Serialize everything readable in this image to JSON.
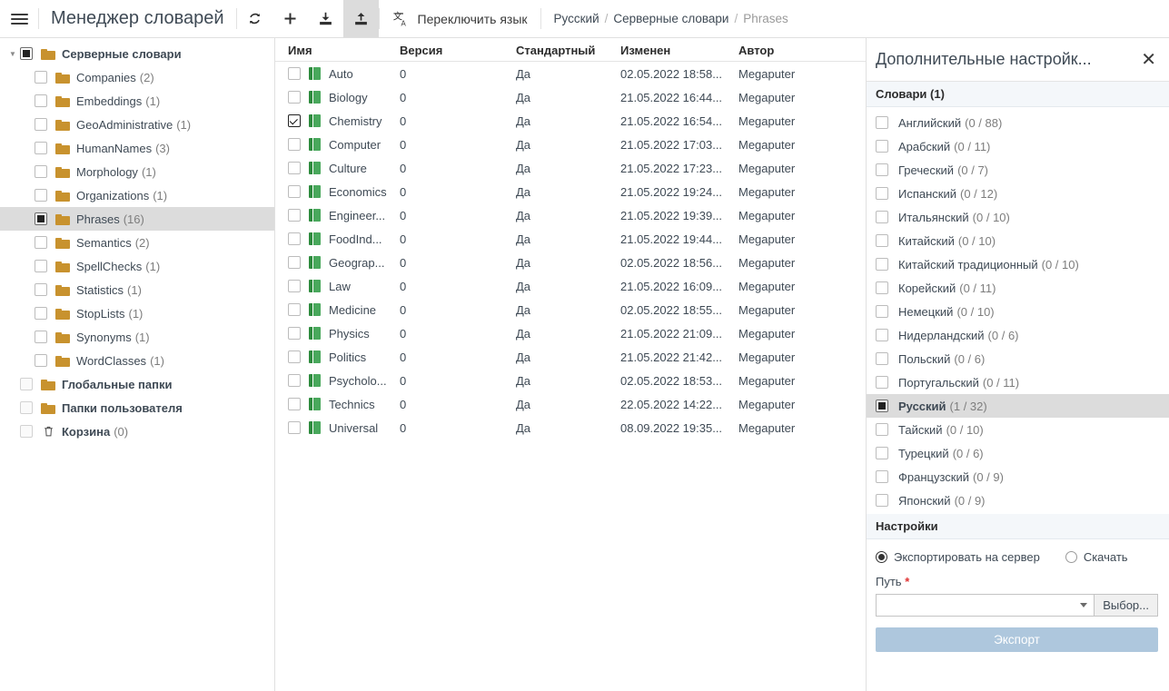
{
  "topbar": {
    "menu_icon": "hamburger-icon",
    "title": "Менеджер словарей",
    "buttons": [
      {
        "name": "refresh-button",
        "icon": "refresh-icon",
        "active": false
      },
      {
        "name": "add-button",
        "icon": "plus-icon",
        "active": false
      },
      {
        "name": "import-button",
        "icon": "download-icon",
        "active": false
      },
      {
        "name": "export-button",
        "icon": "upload-icon",
        "active": true
      }
    ],
    "language_switch": {
      "icon": "translate-icon",
      "label": "Переключить язык"
    },
    "breadcrumb": [
      {
        "label": "Русский",
        "current": false
      },
      {
        "label": "Серверные словари",
        "current": false
      },
      {
        "label": "Phrases",
        "current": true
      }
    ],
    "breadcrumb_separator": "/"
  },
  "sidebar": {
    "items": [
      {
        "label": "Серверные словари",
        "count": "",
        "level": 0,
        "bold": true,
        "icon": "folder-icon",
        "checkbox": "indeterminate",
        "caret": "▼",
        "selected": false
      },
      {
        "label": "Companies",
        "count": "(2)",
        "level": 1,
        "bold": false,
        "icon": "folder-icon",
        "checkbox": "unchecked",
        "caret": "",
        "selected": false
      },
      {
        "label": "Embeddings",
        "count": "(1)",
        "level": 1,
        "bold": false,
        "icon": "folder-icon",
        "checkbox": "unchecked",
        "caret": "",
        "selected": false
      },
      {
        "label": "GeoAdministrative",
        "count": "(1)",
        "level": 1,
        "bold": false,
        "icon": "folder-icon",
        "checkbox": "unchecked",
        "caret": "",
        "selected": false
      },
      {
        "label": "HumanNames",
        "count": "(3)",
        "level": 1,
        "bold": false,
        "icon": "folder-icon",
        "checkbox": "unchecked",
        "caret": "",
        "selected": false
      },
      {
        "label": "Morphology",
        "count": "(1)",
        "level": 1,
        "bold": false,
        "icon": "folder-icon",
        "checkbox": "unchecked",
        "caret": "",
        "selected": false
      },
      {
        "label": "Organizations",
        "count": "(1)",
        "level": 1,
        "bold": false,
        "icon": "folder-icon",
        "checkbox": "unchecked",
        "caret": "",
        "selected": false
      },
      {
        "label": "Phrases",
        "count": "(16)",
        "level": 1,
        "bold": false,
        "icon": "folder-icon",
        "checkbox": "indeterminate",
        "caret": "",
        "selected": true
      },
      {
        "label": "Semantics",
        "count": "(2)",
        "level": 1,
        "bold": false,
        "icon": "folder-icon",
        "checkbox": "unchecked",
        "caret": "",
        "selected": false
      },
      {
        "label": "SpellChecks",
        "count": "(1)",
        "level": 1,
        "bold": false,
        "icon": "folder-icon",
        "checkbox": "unchecked",
        "caret": "",
        "selected": false
      },
      {
        "label": "Statistics",
        "count": "(1)",
        "level": 1,
        "bold": false,
        "icon": "folder-icon",
        "checkbox": "unchecked",
        "caret": "",
        "selected": false
      },
      {
        "label": "StopLists",
        "count": "(1)",
        "level": 1,
        "bold": false,
        "icon": "folder-icon",
        "checkbox": "unchecked",
        "caret": "",
        "selected": false
      },
      {
        "label": "Synonyms",
        "count": "(1)",
        "level": 1,
        "bold": false,
        "icon": "folder-icon",
        "checkbox": "unchecked",
        "caret": "",
        "selected": false
      },
      {
        "label": "WordClasses",
        "count": "(1)",
        "level": 1,
        "bold": false,
        "icon": "folder-icon",
        "checkbox": "unchecked",
        "caret": "",
        "selected": false
      },
      {
        "label": "Глобальные папки",
        "count": "",
        "level": 0,
        "bold": true,
        "icon": "folder-icon",
        "checkbox": "dim",
        "caret": "",
        "selected": false
      },
      {
        "label": "Папки пользователя",
        "count": "",
        "level": 0,
        "bold": true,
        "icon": "folder-icon",
        "checkbox": "dim",
        "caret": "",
        "selected": false
      },
      {
        "label": "Корзина",
        "count": "(0)",
        "level": 0,
        "bold": true,
        "icon": "trash-icon",
        "checkbox": "dim",
        "caret": "",
        "selected": false
      }
    ]
  },
  "table": {
    "columns": [
      "Имя",
      "Версия",
      "Стандартный",
      "Изменен",
      "Автор"
    ],
    "rows": [
      {
        "checkbox": "unchecked",
        "name": "Auto",
        "version": "0",
        "standard": "Да",
        "modified": "02.05.2022 18:58...",
        "author": "Megaputer"
      },
      {
        "checkbox": "unchecked",
        "name": "Biology",
        "version": "0",
        "standard": "Да",
        "modified": "21.05.2022 16:44...",
        "author": "Megaputer"
      },
      {
        "checkbox": "checked",
        "name": "Chemistry",
        "version": "0",
        "standard": "Да",
        "modified": "21.05.2022 16:54...",
        "author": "Megaputer"
      },
      {
        "checkbox": "unchecked",
        "name": "Computer",
        "version": "0",
        "standard": "Да",
        "modified": "21.05.2022 17:03...",
        "author": "Megaputer"
      },
      {
        "checkbox": "unchecked",
        "name": "Culture",
        "version": "0",
        "standard": "Да",
        "modified": "21.05.2022 17:23...",
        "author": "Megaputer"
      },
      {
        "checkbox": "unchecked",
        "name": "Economics",
        "version": "0",
        "standard": "Да",
        "modified": "21.05.2022 19:24...",
        "author": "Megaputer"
      },
      {
        "checkbox": "unchecked",
        "name": "Engineer...",
        "version": "0",
        "standard": "Да",
        "modified": "21.05.2022 19:39...",
        "author": "Megaputer"
      },
      {
        "checkbox": "unchecked",
        "name": "FoodInd...",
        "version": "0",
        "standard": "Да",
        "modified": "21.05.2022 19:44...",
        "author": "Megaputer"
      },
      {
        "checkbox": "unchecked",
        "name": "Geograp...",
        "version": "0",
        "standard": "Да",
        "modified": "02.05.2022 18:56...",
        "author": "Megaputer"
      },
      {
        "checkbox": "unchecked",
        "name": "Law",
        "version": "0",
        "standard": "Да",
        "modified": "21.05.2022 16:09...",
        "author": "Megaputer"
      },
      {
        "checkbox": "unchecked",
        "name": "Medicine",
        "version": "0",
        "standard": "Да",
        "modified": "02.05.2022 18:55...",
        "author": "Megaputer"
      },
      {
        "checkbox": "unchecked",
        "name": "Physics",
        "version": "0",
        "standard": "Да",
        "modified": "21.05.2022 21:09...",
        "author": "Megaputer"
      },
      {
        "checkbox": "unchecked",
        "name": "Politics",
        "version": "0",
        "standard": "Да",
        "modified": "21.05.2022 21:42...",
        "author": "Megaputer"
      },
      {
        "checkbox": "unchecked",
        "name": "Psycholo...",
        "version": "0",
        "standard": "Да",
        "modified": "02.05.2022 18:53...",
        "author": "Megaputer"
      },
      {
        "checkbox": "unchecked",
        "name": "Technics",
        "version": "0",
        "standard": "Да",
        "modified": "22.05.2022 14:22...",
        "author": "Megaputer"
      },
      {
        "checkbox": "unchecked",
        "name": "Universal",
        "version": "0",
        "standard": "Да",
        "modified": "08.09.2022 19:35...",
        "author": "Megaputer"
      }
    ]
  },
  "right_panel": {
    "title": "Дополнительные настройк...",
    "close_icon": "close-icon",
    "dictionaries_header": "Словари (1)",
    "languages": [
      {
        "label": "Английский",
        "count": "(0 / 88)",
        "checkbox": "unchecked",
        "selected": false
      },
      {
        "label": "Арабский",
        "count": "(0 / 11)",
        "checkbox": "unchecked",
        "selected": false
      },
      {
        "label": "Греческий",
        "count": "(0 / 7)",
        "checkbox": "unchecked",
        "selected": false
      },
      {
        "label": "Испанский",
        "count": "(0 / 12)",
        "checkbox": "unchecked",
        "selected": false
      },
      {
        "label": "Итальянский",
        "count": "(0 / 10)",
        "checkbox": "unchecked",
        "selected": false
      },
      {
        "label": "Китайский",
        "count": "(0 / 10)",
        "checkbox": "unchecked",
        "selected": false
      },
      {
        "label": "Китайский традиционный",
        "count": "(0 / 10)",
        "checkbox": "unchecked",
        "selected": false
      },
      {
        "label": "Корейский",
        "count": "(0 / 11)",
        "checkbox": "unchecked",
        "selected": false
      },
      {
        "label": "Немецкий",
        "count": "(0 / 10)",
        "checkbox": "unchecked",
        "selected": false
      },
      {
        "label": "Нидерландский",
        "count": "(0 / 6)",
        "checkbox": "unchecked",
        "selected": false
      },
      {
        "label": "Польский",
        "count": "(0 / 6)",
        "checkbox": "unchecked",
        "selected": false
      },
      {
        "label": "Португальский",
        "count": "(0 / 11)",
        "checkbox": "unchecked",
        "selected": false
      },
      {
        "label": "Русский",
        "count": "(1 / 32)",
        "checkbox": "indeterminate",
        "selected": true
      },
      {
        "label": "Тайский",
        "count": "(0 / 10)",
        "checkbox": "unchecked",
        "selected": false
      },
      {
        "label": "Турецкий",
        "count": "(0 / 6)",
        "checkbox": "unchecked",
        "selected": false
      },
      {
        "label": "Французский",
        "count": "(0 / 9)",
        "checkbox": "unchecked",
        "selected": false
      },
      {
        "label": "Японский",
        "count": "(0 / 9)",
        "checkbox": "unchecked",
        "selected": false
      }
    ],
    "settings_header": "Настройки",
    "destination_options": [
      {
        "label": "Экспортировать на сервер",
        "selected": true
      },
      {
        "label": "Скачать",
        "selected": false
      }
    ],
    "path_label": "Путь",
    "path_required_marker": "*",
    "path_value": "",
    "browse_label": "Выбор...",
    "export_label": "Экспорт"
  },
  "colors": {
    "folder": "#c8922e",
    "book": "#49a85c",
    "selection": "#dcdcdc",
    "section_header_bg": "#f4f7fa",
    "export_button": "#aec7dd",
    "required": "#e03131"
  }
}
